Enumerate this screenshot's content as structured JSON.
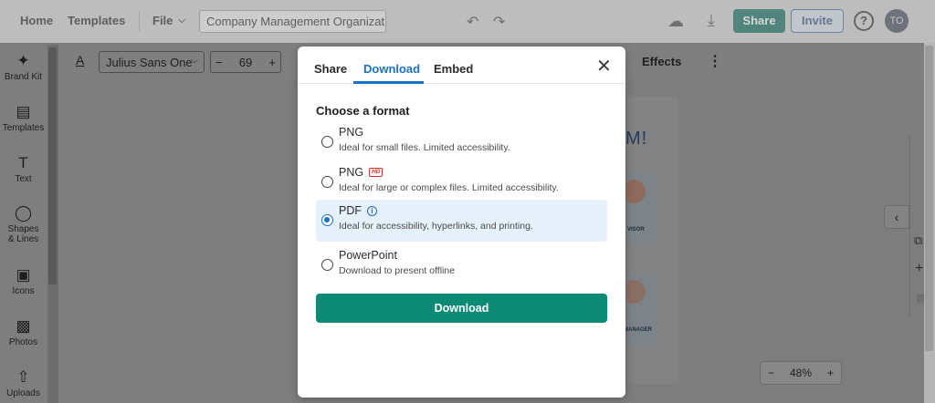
{
  "topbar": {
    "home": "Home",
    "templates": "Templates",
    "file": "File",
    "doc_title": "Company Management Organizati...",
    "share": "Share",
    "invite": "Invite",
    "help": "?",
    "avatar_initials": "TO"
  },
  "sidebar": {
    "items": [
      {
        "label": "Brand Kit",
        "icon": "magic-wand-icon"
      },
      {
        "label": "Templates",
        "icon": "templates-icon"
      },
      {
        "label": "Text",
        "icon": "text-icon"
      },
      {
        "label": "Shapes & Lines",
        "icon": "shapes-icon"
      },
      {
        "label": "Icons",
        "icon": "icons-icon"
      },
      {
        "label": "Photos",
        "icon": "photos-icon"
      },
      {
        "label": "Uploads",
        "icon": "upload-icon"
      }
    ]
  },
  "toolbar": {
    "font_family": "Julius Sans One",
    "font_size": "69",
    "minus": "−",
    "plus": "+",
    "effects": "Effects"
  },
  "canvas": {
    "zoom": "48%",
    "zoom_minus": "−",
    "zoom_plus": "+",
    "card1_role": "VISOR",
    "card2_role": "MANAGER",
    "title_fragment": "M!"
  },
  "modal": {
    "tabs": [
      "Share",
      "Download",
      "Embed"
    ],
    "active_tab": "Download",
    "heading": "Choose a format",
    "options": [
      {
        "title": "PNG",
        "desc": "Ideal for small files. Limited accessibility.",
        "selected": false
      },
      {
        "title": "PNG",
        "badge": "HD",
        "desc": "Ideal for large or complex files. Limited accessibility.",
        "selected": false
      },
      {
        "title": "PDF",
        "info": "i",
        "desc": "Ideal for accessibility, hyperlinks, and printing.",
        "selected": true
      },
      {
        "title": "PowerPoint",
        "desc": "Download to present offline",
        "selected": false
      }
    ],
    "download_button": "Download"
  },
  "colors": {
    "accent": "#1a6fc6",
    "download": "#0b8a75",
    "share": "#0a5f52"
  }
}
